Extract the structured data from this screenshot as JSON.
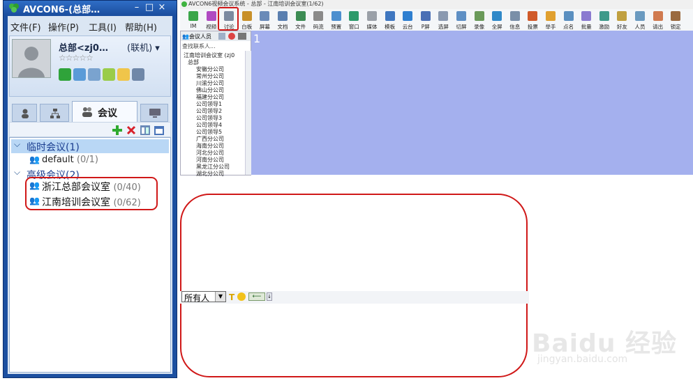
{
  "client": {
    "title": "AVCON6-(总部…",
    "window_controls": [
      "–",
      "□",
      "×"
    ],
    "menu": [
      "文件(F)",
      "操作(P)",
      "工具(I)",
      "帮助(H)"
    ],
    "profile": {
      "name": "总部<zj0…",
      "status": "(联机)",
      "status_arrow": "▾",
      "stars": "☆☆☆☆☆"
    },
    "tabs": [
      {
        "icon": "person-icon"
      },
      {
        "icon": "org-chart-icon"
      },
      {
        "icon": "meeting-icon",
        "label": "会议"
      },
      {
        "icon": "monitor-icon"
      }
    ],
    "tree": {
      "groups": [
        {
          "label": "临时会议",
          "count": "(1)",
          "rooms": [
            {
              "name": "default",
              "count": "(0/1)"
            }
          ]
        },
        {
          "label": "高级会议",
          "count": "(2)",
          "rooms": [
            {
              "name": "浙江总部会议室",
              "count": "(0/40)"
            },
            {
              "name": "江南培训会议室",
              "count": "(0/62)"
            }
          ]
        }
      ]
    }
  },
  "conference": {
    "title": "AVCON6视频会议系统 - 总部 - 江南培训会议室(1/62)",
    "toolbar": [
      "IM",
      "视频",
      "讨论",
      "白板",
      "屏幕",
      "文档",
      "文件",
      "码流",
      "预置",
      "窗口",
      "媒体",
      "模板",
      "云台",
      "P屏",
      "选屏",
      "切屏",
      "录像",
      "全屏",
      "信息",
      "投票",
      "举手",
      "点名",
      "批量",
      "激励",
      "好友",
      "人员",
      "请出",
      "锁定"
    ],
    "member_tabs": {
      "first": "会议人员"
    },
    "search_label": "查找联系人...",
    "members": {
      "room": "江南培训会议室 (zj0",
      "root": "总部",
      "items": [
        "安徽分公司",
        "常州分公司",
        "川渝分公司",
        "佛山分公司",
        "福建分公司",
        "公司领导1",
        "公司领导2",
        "公司领导3",
        "公司领导4",
        "公司领导5",
        "广西分公司",
        "海南分公司",
        "河北分公司",
        "河南分公司",
        "黑龙江分公司",
        "湖北分公司"
      ]
    },
    "video_index": "1",
    "chat": {
      "recipient": "所有人"
    }
  },
  "watermark": {
    "logo": "Baidu 经验",
    "url": "jingyan.baidu.com"
  },
  "colors": {
    "highlight": "#d01818",
    "video_bg": "#a4b0ee",
    "client_frame": "#1c4fa0"
  }
}
